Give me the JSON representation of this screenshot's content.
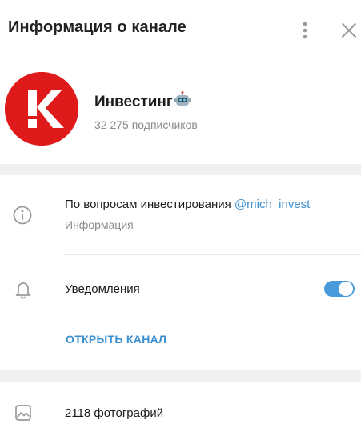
{
  "header": {
    "title": "Информация о канале",
    "icons": {
      "more": "more-vertical-icon",
      "close": "close-icon"
    }
  },
  "channel": {
    "avatar_letter": "K",
    "avatar_color": "#de1a1a",
    "name": "Инвестинг",
    "name_emoji": "robot-icon",
    "subscribers": "32 275 подписчиков"
  },
  "info": {
    "text": "По вопросам инвестирования ",
    "link": "@mich_invest",
    "label": "Информация",
    "icon": "info-icon"
  },
  "notifications": {
    "label": "Уведомления",
    "enabled": true,
    "icon": "bell-icon"
  },
  "open_channel": {
    "label": "ОТКРЫТЬ КАНАЛ"
  },
  "media": {
    "photos_label": "2118 фотографий",
    "icon": "image-icon"
  },
  "colors": {
    "accent": "#3a8fd0",
    "toggle": "#4a9bdc",
    "secondary_text": "#8a8a8a",
    "band": "#f0f0f0"
  }
}
